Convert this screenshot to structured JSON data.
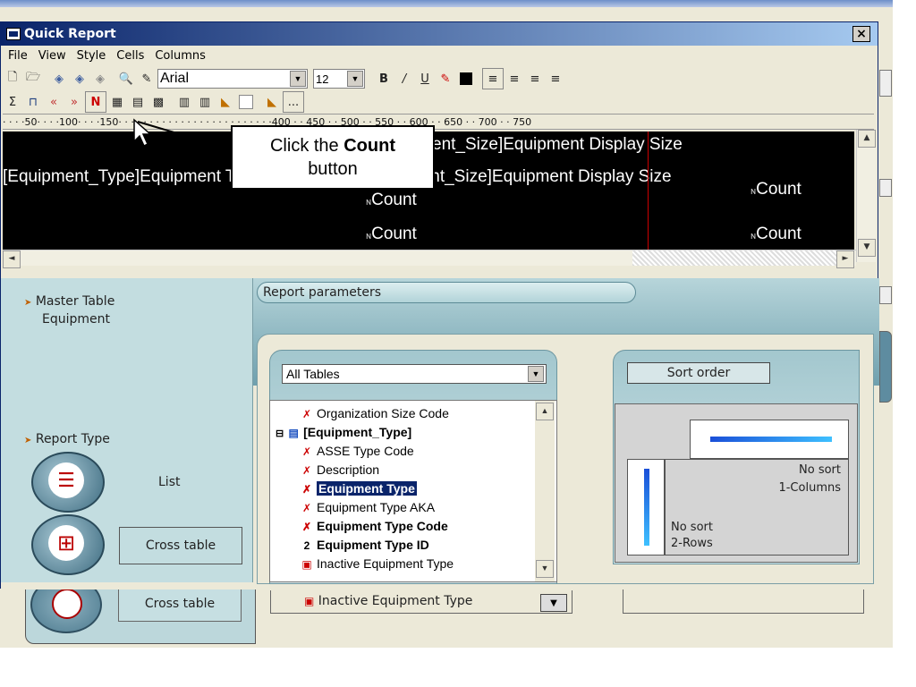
{
  "window": {
    "title": "Quick Report",
    "close_label": "×"
  },
  "menu": [
    "File",
    "View",
    "Style",
    "Cells",
    "Columns"
  ],
  "toolbar": {
    "font_name": "Arial",
    "font_size": "12",
    "bold": "B",
    "italic": "/",
    "underline": "U",
    "ellipsis": "..."
  },
  "ruler": {
    "text": "· · · ·50· · · ·100· · · ·150· · · · · · · · · · · · · · · · · · · · · · · · ·400 · · 450 · · 500 · · 550 · · 600 · · 650 · · 700 · · 750"
  },
  "report": {
    "line1": "ent_Size]Equipment Display Size",
    "line2_a": "[Equipment_Type]Equipment Type",
    "line2_b": "[Equipment_Size]Equipment Display Size",
    "count1": "Count",
    "count2": "Count",
    "count3": "Count",
    "count4": "Count"
  },
  "callout": {
    "prefix": "Click the ",
    "bold": "Count",
    "suffix": "button"
  },
  "left_panel": {
    "master_label": "Master Table",
    "master_value": "Equipment",
    "report_type_label": "Report Type",
    "list_label": "List",
    "cross_table_label": "Cross table"
  },
  "params": {
    "tab_label": "Report parameters",
    "tables_combo": "All Tables"
  },
  "tree": [
    {
      "label": "Organization Size Code",
      "bold": false,
      "icon": "field-icon"
    },
    {
      "label": "[Equipment_Type]",
      "bold": true,
      "icon": "table-icon"
    },
    {
      "label": "ASSE Type Code",
      "bold": false,
      "icon": "field-icon"
    },
    {
      "label": "Description",
      "bold": false,
      "icon": "field-icon"
    },
    {
      "label": "Equipment Type",
      "bold": true,
      "icon": "field-icon",
      "selected": true
    },
    {
      "label": "Equipment Type AKA",
      "bold": false,
      "icon": "field-icon"
    },
    {
      "label": "Equipment Type Code",
      "bold": true,
      "icon": "field-icon"
    },
    {
      "label": "Equipment Type ID",
      "bold": true,
      "icon": "number-icon"
    },
    {
      "label": "Inactive Equipment Type",
      "bold": false,
      "icon": "boolean-icon"
    }
  ],
  "sort": {
    "button_label": "Sort order",
    "col_sort": "No sort",
    "col_label": "1-Columns",
    "row_sort": "No sort",
    "row_label": "2-Rows"
  },
  "background": {
    "cross_table_label": "Cross table",
    "tree_item": "Inactive Equipment Type"
  },
  "colors": {
    "title_start": "#0a246a",
    "title_end": "#a6caf0",
    "selection": "#0a246a",
    "accent_teal": "#6fa0ae",
    "red_line": "#cc0000"
  }
}
